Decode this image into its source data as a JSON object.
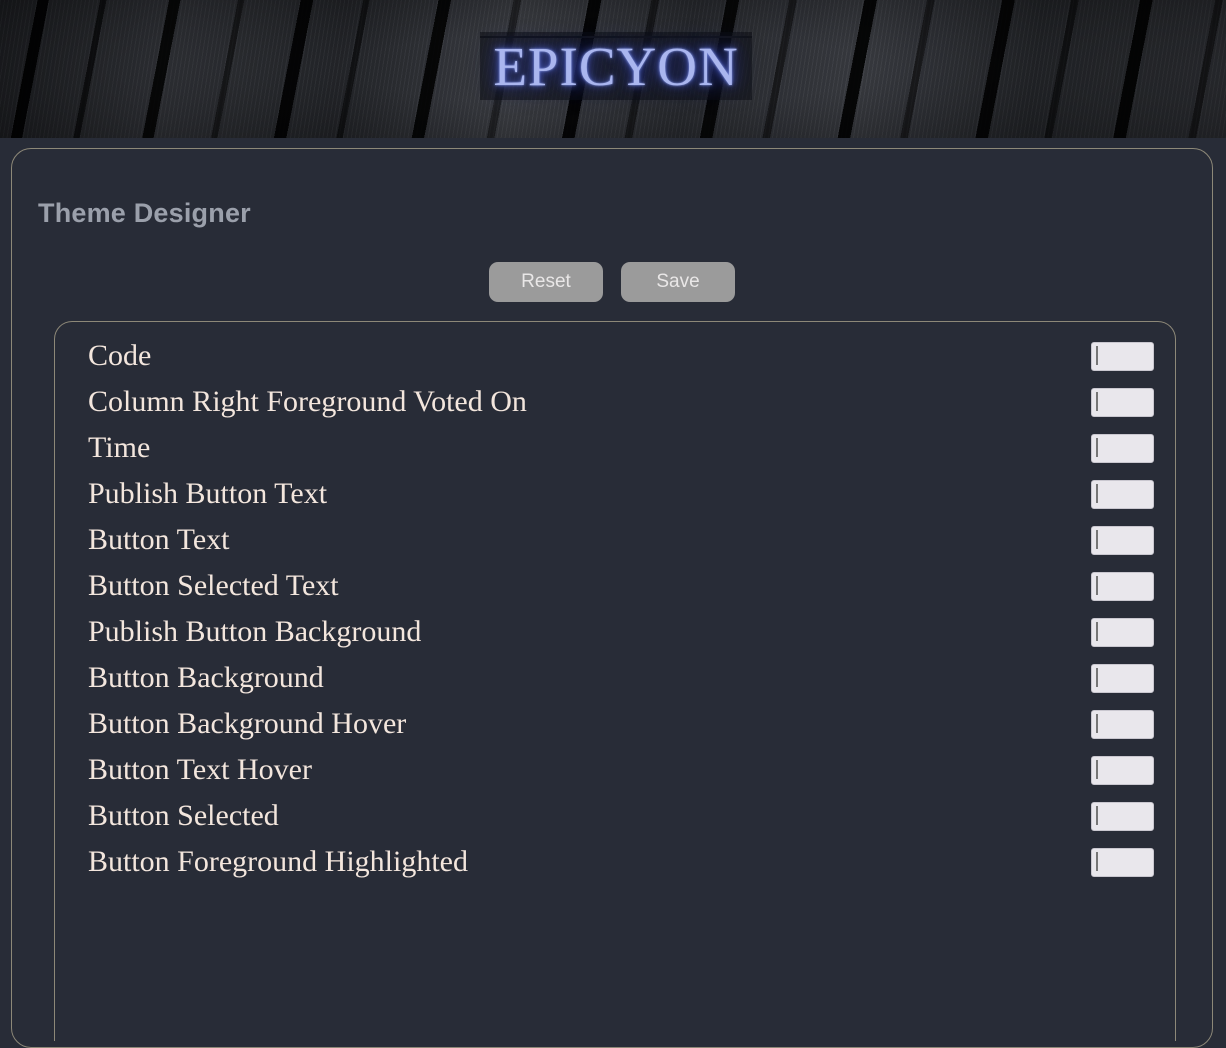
{
  "banner": {
    "logo_text": "EPICYON"
  },
  "page": {
    "title": "Theme Designer"
  },
  "toolbar": {
    "reset_label": "Reset",
    "save_label": "Save"
  },
  "theme_items": [
    {
      "label": "Code",
      "color": "#add8e6"
    },
    {
      "label": "Column Right Foreground Voted On",
      "color": "#ff0000"
    },
    {
      "label": "Time",
      "color": "#000000"
    },
    {
      "label": "Publish Button Text",
      "color": "#ffffff"
    },
    {
      "label": "Button Text",
      "color": "#ffffff"
    },
    {
      "label": "Button Selected Text",
      "color": "#ffffff"
    },
    {
      "label": "Publish Button Background",
      "color": "#000000"
    },
    {
      "label": "Button Background",
      "color": "#000000"
    },
    {
      "label": "Button Background Hover",
      "color": "#000000"
    },
    {
      "label": "Button Text Hover",
      "color": "#ffffff"
    },
    {
      "label": "Button Selected",
      "color": "#000000"
    },
    {
      "label": "Button Foreground Highlighted",
      "color": "#ffffff"
    }
  ],
  "colors": {
    "page_background": "#282c37",
    "panel_border": "#8d8878",
    "title_text": "#9ba0ab",
    "row_label_text": "#f3e6dd",
    "button_background": "#9b9b9b",
    "button_text": "#e9e7e7",
    "logo_glow": "#aab6ef"
  }
}
